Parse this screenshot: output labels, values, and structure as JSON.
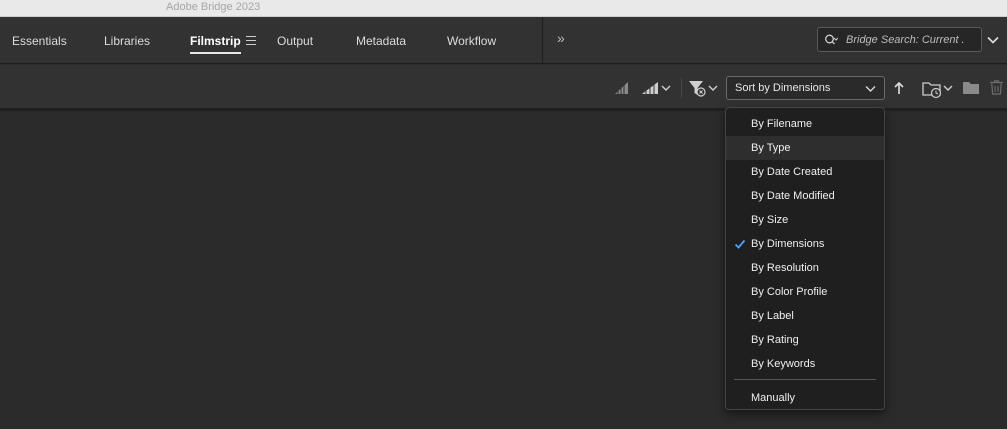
{
  "window": {
    "title": "Adobe Bridge 2023"
  },
  "workspaces": {
    "tabs": [
      {
        "label": "Essentials"
      },
      {
        "label": "Libraries"
      },
      {
        "label": "Filmstrip"
      },
      {
        "label": "Output"
      },
      {
        "label": "Metadata"
      },
      {
        "label": "Workflow"
      }
    ],
    "active": "Filmstrip"
  },
  "search": {
    "placeholder": "Bridge Search: Current ."
  },
  "toolbar": {
    "sort_label": "Sort by Dimensions",
    "icons": [
      "quality-icon",
      "thumbnail-quality-menu-icon",
      "filter-items-icon",
      "sort-direction-icon",
      "recent-folder-icon",
      "new-folder-icon",
      "delete-icon"
    ]
  },
  "sort_menu": {
    "items": [
      {
        "label": "By Filename"
      },
      {
        "label": "By Type"
      },
      {
        "label": "By Date Created"
      },
      {
        "label": "By Date Modified"
      },
      {
        "label": "By Size"
      },
      {
        "label": "By Dimensions"
      },
      {
        "label": "By Resolution"
      },
      {
        "label": "By Color Profile"
      },
      {
        "label": "By Label"
      },
      {
        "label": "By Rating"
      },
      {
        "label": "By Keywords"
      }
    ],
    "selected": "By Dimensions",
    "hovered": "By Type",
    "manual": "Manually"
  },
  "colors": {
    "accent_check": "#4aa3ff",
    "panel": "#323232",
    "background": "#2b2b2b"
  }
}
